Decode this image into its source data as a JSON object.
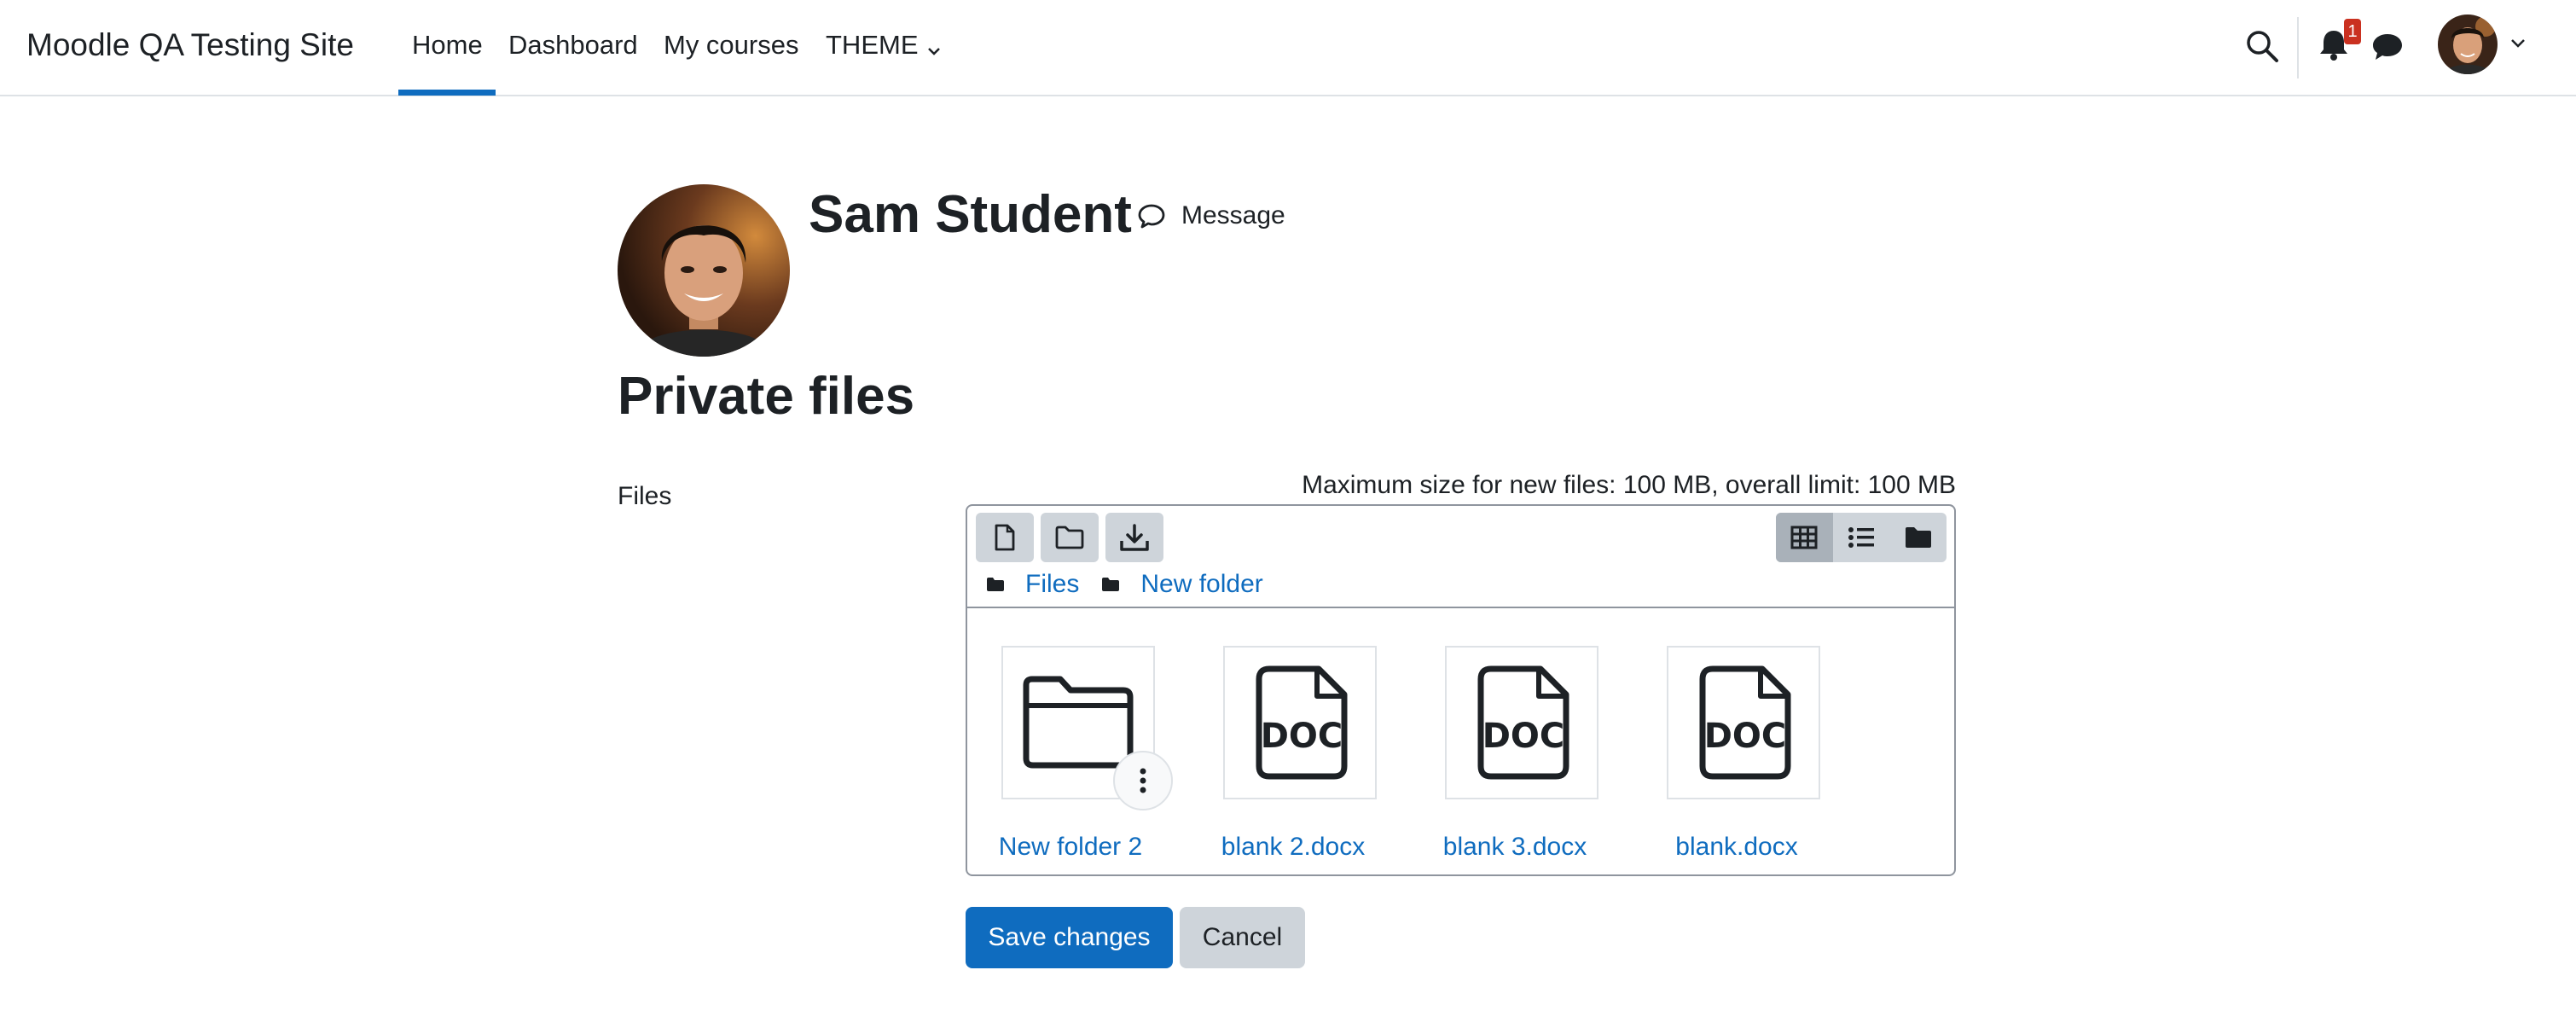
{
  "navbar": {
    "site_name": "Moodle QA Testing Site",
    "items": [
      {
        "label": "Home",
        "active": true
      },
      {
        "label": "Dashboard",
        "active": false
      },
      {
        "label": "My courses",
        "active": false
      },
      {
        "label": "THEME",
        "active": false
      }
    ],
    "notification_count": "1",
    "icons": [
      "search-icon",
      "bell-icon",
      "chat-icon",
      "user-menu-chevron-icon"
    ]
  },
  "profile": {
    "name": "Sam Student",
    "message_label": "Message"
  },
  "page": {
    "title": "Private files"
  },
  "form": {
    "files_label": "Files",
    "max_size_text": "Maximum size for new files: 100 MB, overall limit: 100 MB",
    "toolbar": {
      "left_icons": [
        "add-file-icon",
        "create-folder-icon",
        "download-icon"
      ],
      "view_icons": [
        "grid-view-icon",
        "list-view-icon",
        "tree-view-icon"
      ],
      "active_view": "grid-view-icon"
    },
    "breadcrumbs": [
      {
        "label": "Files"
      },
      {
        "label": "New folder"
      }
    ],
    "files": [
      {
        "name": "New folder 2",
        "type": "folder"
      },
      {
        "name": "blank 2.docx",
        "type": "doc",
        "icon_text": "DOC"
      },
      {
        "name": "blank 3.docx",
        "type": "doc",
        "icon_text": "DOC"
      },
      {
        "name": "blank.docx",
        "type": "doc",
        "icon_text": "DOC"
      }
    ]
  },
  "buttons": {
    "save": "Save changes",
    "cancel": "Cancel"
  },
  "colors": {
    "primary": "#0f6cbf",
    "badge": "#ca3120",
    "secondary_button": "#ced4da",
    "text": "#1d2125",
    "border": "#8f959e"
  }
}
